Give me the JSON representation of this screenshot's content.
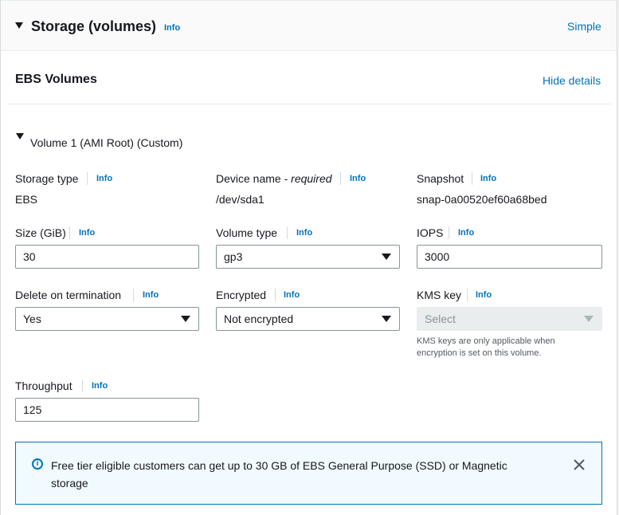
{
  "header": {
    "title": "Storage (volumes)",
    "info": "Info",
    "mode_link": "Simple"
  },
  "ebs": {
    "title": "EBS Volumes",
    "hide_details": "Hide details"
  },
  "volume": {
    "title": "Volume 1 (AMI Root) (Custom)",
    "storage_type": {
      "label": "Storage type",
      "info": "Info",
      "value": "EBS"
    },
    "device_name": {
      "label": "Device name - ",
      "required": "required",
      "info": "Info",
      "value": "/dev/sda1"
    },
    "snapshot": {
      "label": "Snapshot",
      "info": "Info",
      "value": "snap-0a00520ef60a68bed"
    },
    "size": {
      "label": "Size (GiB)",
      "info": "Info",
      "value": "30"
    },
    "volume_type": {
      "label": "Volume type",
      "info": "Info",
      "value": "gp3"
    },
    "iops": {
      "label": "IOPS",
      "info": "Info",
      "value": "3000"
    },
    "delete_on_termination": {
      "label": "Delete on termination",
      "info": "Info",
      "value": "Yes"
    },
    "encrypted": {
      "label": "Encrypted",
      "info": "Info",
      "value": "Not encrypted"
    },
    "kms_key": {
      "label": "KMS key",
      "info": "Info",
      "placeholder": "Select",
      "hint": "KMS keys are only applicable when encryption is set on this volume."
    },
    "throughput": {
      "label": "Throughput",
      "info": "Info",
      "value": "125"
    }
  },
  "alert": {
    "text": "Free tier eligible customers can get up to 30 GB of EBS General Purpose (SSD) or Magnetic storage"
  },
  "colors": {
    "link": "#0073bb",
    "alert_bg": "#f1faff",
    "alert_border": "#0073bb"
  },
  "icons": [
    "caret-down-icon",
    "chevron-down-icon",
    "info-circle-icon",
    "close-icon"
  ]
}
